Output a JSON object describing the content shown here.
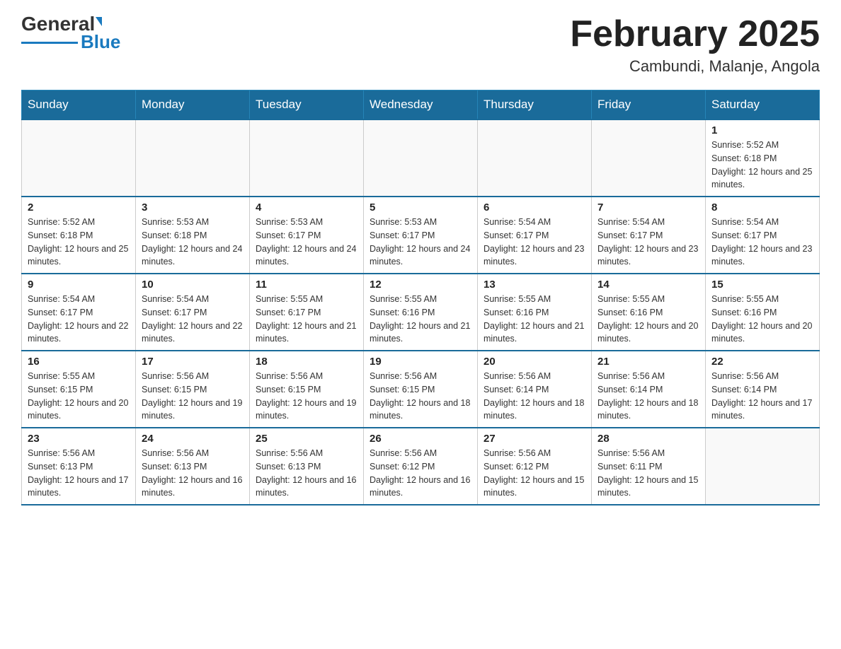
{
  "header": {
    "logo_text_black": "General",
    "logo_text_blue": "Blue",
    "month_title": "February 2025",
    "location": "Cambundi, Malanje, Angola"
  },
  "days_of_week": [
    "Sunday",
    "Monday",
    "Tuesday",
    "Wednesday",
    "Thursday",
    "Friday",
    "Saturday"
  ],
  "weeks": [
    [
      {
        "day": "",
        "sunrise": "",
        "sunset": "",
        "daylight": ""
      },
      {
        "day": "",
        "sunrise": "",
        "sunset": "",
        "daylight": ""
      },
      {
        "day": "",
        "sunrise": "",
        "sunset": "",
        "daylight": ""
      },
      {
        "day": "",
        "sunrise": "",
        "sunset": "",
        "daylight": ""
      },
      {
        "day": "",
        "sunrise": "",
        "sunset": "",
        "daylight": ""
      },
      {
        "day": "",
        "sunrise": "",
        "sunset": "",
        "daylight": ""
      },
      {
        "day": "1",
        "sunrise": "Sunrise: 5:52 AM",
        "sunset": "Sunset: 6:18 PM",
        "daylight": "Daylight: 12 hours and 25 minutes."
      }
    ],
    [
      {
        "day": "2",
        "sunrise": "Sunrise: 5:52 AM",
        "sunset": "Sunset: 6:18 PM",
        "daylight": "Daylight: 12 hours and 25 minutes."
      },
      {
        "day": "3",
        "sunrise": "Sunrise: 5:53 AM",
        "sunset": "Sunset: 6:18 PM",
        "daylight": "Daylight: 12 hours and 24 minutes."
      },
      {
        "day": "4",
        "sunrise": "Sunrise: 5:53 AM",
        "sunset": "Sunset: 6:17 PM",
        "daylight": "Daylight: 12 hours and 24 minutes."
      },
      {
        "day": "5",
        "sunrise": "Sunrise: 5:53 AM",
        "sunset": "Sunset: 6:17 PM",
        "daylight": "Daylight: 12 hours and 24 minutes."
      },
      {
        "day": "6",
        "sunrise": "Sunrise: 5:54 AM",
        "sunset": "Sunset: 6:17 PM",
        "daylight": "Daylight: 12 hours and 23 minutes."
      },
      {
        "day": "7",
        "sunrise": "Sunrise: 5:54 AM",
        "sunset": "Sunset: 6:17 PM",
        "daylight": "Daylight: 12 hours and 23 minutes."
      },
      {
        "day": "8",
        "sunrise": "Sunrise: 5:54 AM",
        "sunset": "Sunset: 6:17 PM",
        "daylight": "Daylight: 12 hours and 23 minutes."
      }
    ],
    [
      {
        "day": "9",
        "sunrise": "Sunrise: 5:54 AM",
        "sunset": "Sunset: 6:17 PM",
        "daylight": "Daylight: 12 hours and 22 minutes."
      },
      {
        "day": "10",
        "sunrise": "Sunrise: 5:54 AM",
        "sunset": "Sunset: 6:17 PM",
        "daylight": "Daylight: 12 hours and 22 minutes."
      },
      {
        "day": "11",
        "sunrise": "Sunrise: 5:55 AM",
        "sunset": "Sunset: 6:17 PM",
        "daylight": "Daylight: 12 hours and 21 minutes."
      },
      {
        "day": "12",
        "sunrise": "Sunrise: 5:55 AM",
        "sunset": "Sunset: 6:16 PM",
        "daylight": "Daylight: 12 hours and 21 minutes."
      },
      {
        "day": "13",
        "sunrise": "Sunrise: 5:55 AM",
        "sunset": "Sunset: 6:16 PM",
        "daylight": "Daylight: 12 hours and 21 minutes."
      },
      {
        "day": "14",
        "sunrise": "Sunrise: 5:55 AM",
        "sunset": "Sunset: 6:16 PM",
        "daylight": "Daylight: 12 hours and 20 minutes."
      },
      {
        "day": "15",
        "sunrise": "Sunrise: 5:55 AM",
        "sunset": "Sunset: 6:16 PM",
        "daylight": "Daylight: 12 hours and 20 minutes."
      }
    ],
    [
      {
        "day": "16",
        "sunrise": "Sunrise: 5:55 AM",
        "sunset": "Sunset: 6:15 PM",
        "daylight": "Daylight: 12 hours and 20 minutes."
      },
      {
        "day": "17",
        "sunrise": "Sunrise: 5:56 AM",
        "sunset": "Sunset: 6:15 PM",
        "daylight": "Daylight: 12 hours and 19 minutes."
      },
      {
        "day": "18",
        "sunrise": "Sunrise: 5:56 AM",
        "sunset": "Sunset: 6:15 PM",
        "daylight": "Daylight: 12 hours and 19 minutes."
      },
      {
        "day": "19",
        "sunrise": "Sunrise: 5:56 AM",
        "sunset": "Sunset: 6:15 PM",
        "daylight": "Daylight: 12 hours and 18 minutes."
      },
      {
        "day": "20",
        "sunrise": "Sunrise: 5:56 AM",
        "sunset": "Sunset: 6:14 PM",
        "daylight": "Daylight: 12 hours and 18 minutes."
      },
      {
        "day": "21",
        "sunrise": "Sunrise: 5:56 AM",
        "sunset": "Sunset: 6:14 PM",
        "daylight": "Daylight: 12 hours and 18 minutes."
      },
      {
        "day": "22",
        "sunrise": "Sunrise: 5:56 AM",
        "sunset": "Sunset: 6:14 PM",
        "daylight": "Daylight: 12 hours and 17 minutes."
      }
    ],
    [
      {
        "day": "23",
        "sunrise": "Sunrise: 5:56 AM",
        "sunset": "Sunset: 6:13 PM",
        "daylight": "Daylight: 12 hours and 17 minutes."
      },
      {
        "day": "24",
        "sunrise": "Sunrise: 5:56 AM",
        "sunset": "Sunset: 6:13 PM",
        "daylight": "Daylight: 12 hours and 16 minutes."
      },
      {
        "day": "25",
        "sunrise": "Sunrise: 5:56 AM",
        "sunset": "Sunset: 6:13 PM",
        "daylight": "Daylight: 12 hours and 16 minutes."
      },
      {
        "day": "26",
        "sunrise": "Sunrise: 5:56 AM",
        "sunset": "Sunset: 6:12 PM",
        "daylight": "Daylight: 12 hours and 16 minutes."
      },
      {
        "day": "27",
        "sunrise": "Sunrise: 5:56 AM",
        "sunset": "Sunset: 6:12 PM",
        "daylight": "Daylight: 12 hours and 15 minutes."
      },
      {
        "day": "28",
        "sunrise": "Sunrise: 5:56 AM",
        "sunset": "Sunset: 6:11 PM",
        "daylight": "Daylight: 12 hours and 15 minutes."
      },
      {
        "day": "",
        "sunrise": "",
        "sunset": "",
        "daylight": ""
      }
    ]
  ]
}
